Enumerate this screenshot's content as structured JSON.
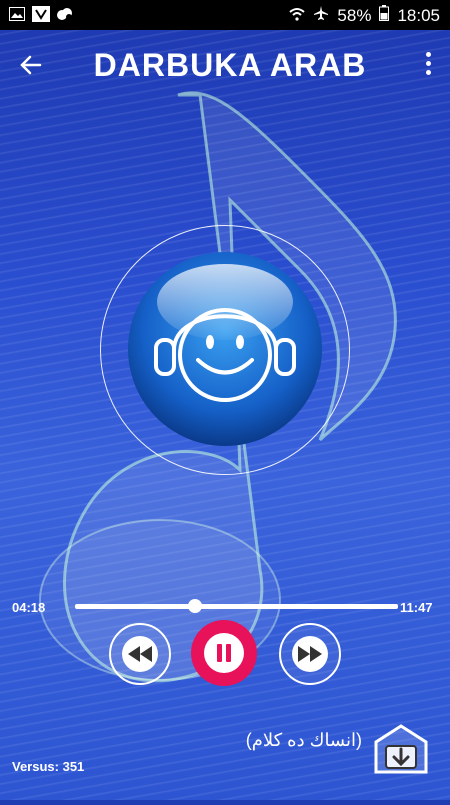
{
  "status_bar": {
    "battery": "58%",
    "time": "18:05",
    "left_icons": [
      "image-icon",
      "shield-icon",
      "cloud-icon"
    ],
    "right_icons": [
      "wifi-icon",
      "airplane-icon",
      "battery-icon"
    ]
  },
  "toolbar": {
    "title": "DARBUKA ARAB",
    "back_icon": "arrow-left-icon",
    "menu_icon": "overflow-menu-icon"
  },
  "player": {
    "artwork_icon": "smiley-headphones-icon",
    "elapsed": "04:18",
    "total": "11:47",
    "progress_fraction": 0.37,
    "song_title": "(انساك ده كلام)",
    "version": "Versus: 351"
  },
  "colors": {
    "accent": "#e8125a",
    "background": "#2a4ed0"
  }
}
